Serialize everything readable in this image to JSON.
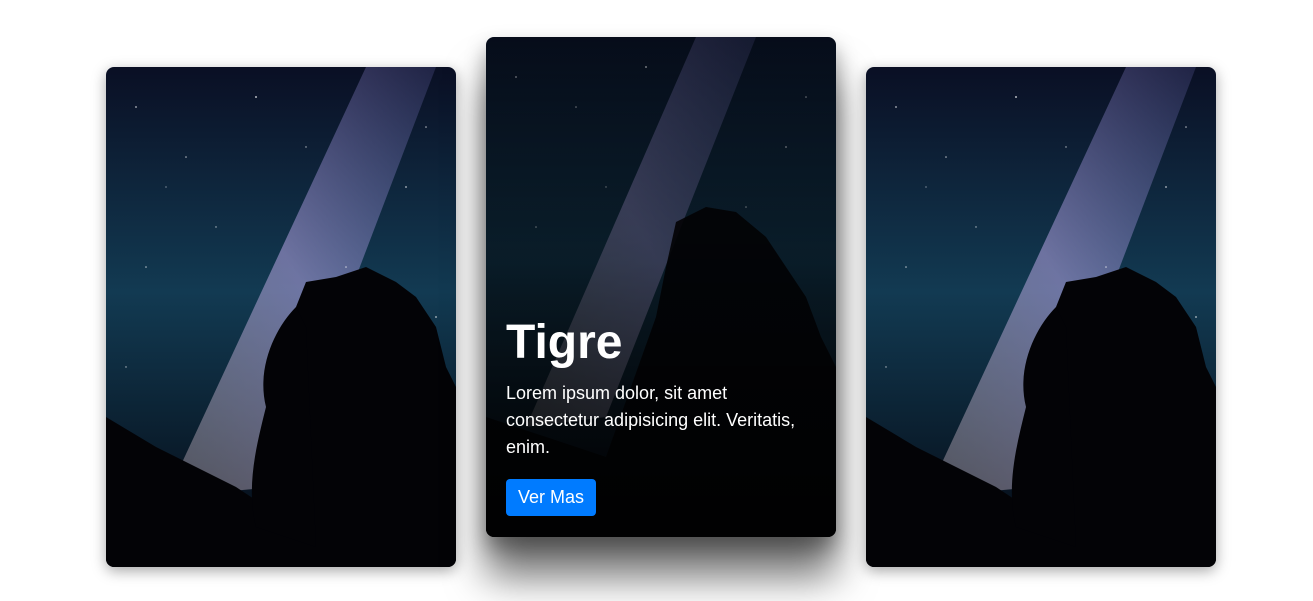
{
  "cards": [
    {
      "id": "left",
      "image": "night-sky-milky-way-trees"
    },
    {
      "id": "center",
      "image": "night-sky-milky-way-trees",
      "title": "Tigre",
      "description": "Lorem ipsum dolor, sit amet consectetur adipisicing elit. Veritatis, enim.",
      "button_label": "Ver Mas"
    },
    {
      "id": "right",
      "image": "night-sky-milky-way-trees"
    }
  ],
  "colors": {
    "button": "#007bff",
    "sky_dark": "#04060f",
    "sky_mid": "#123a52",
    "milky_way": "#b9a6e6"
  }
}
